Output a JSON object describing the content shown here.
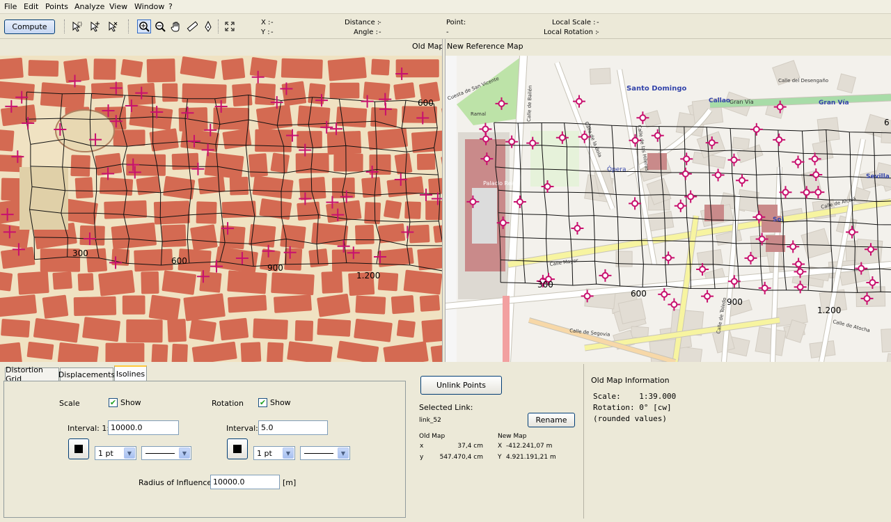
{
  "menu": [
    "File",
    "Edit",
    "Points",
    "Analyze",
    "View",
    "Window",
    "?"
  ],
  "toolbar": {
    "compute_label": "Compute",
    "tools": [
      "select-icon",
      "select-add-icon",
      "select-remove-icon",
      "zoom-in-icon",
      "zoom-out-icon",
      "pan-hand-icon",
      "measure-ruler-icon",
      "pen-icon",
      "fit-extent-icon"
    ],
    "x_label": "X :",
    "x_value": "-",
    "y_label": "Y :",
    "y_value": "-",
    "distance_label": "Distance :",
    "distance_value": "-",
    "angle_label": "Angle :",
    "angle_value": "-",
    "point_label": "Point:",
    "point_value": "-",
    "local_scale_label": "Local Scale :",
    "local_scale_value": "-",
    "local_rotation_label": "Local Rotation :",
    "local_rotation_value": "-"
  },
  "old_map": {
    "title": "Old Map",
    "grid_labels": [
      "300",
      "600",
      "900",
      "1.200",
      "600"
    ]
  },
  "new_map": {
    "title": "New Reference Map",
    "place_labels": [
      "Santo Domingo",
      "Callao",
      "Gran Vía",
      "Gran Vía",
      "Ópera",
      "Sevilla",
      "Sol",
      "Palacio Real"
    ],
    "street_labels": [
      "Calle de Bailén",
      "Calle Mayor",
      "Calle de Segovia",
      "Calle de Toledo",
      "Calle de Alcalá",
      "Calle del Desengaño",
      "Calle de las Hileras",
      "Calle de Atocha",
      "Calle de la Bola",
      "Ramal",
      "Cuesta de San Vicente"
    ],
    "grid_labels": [
      "300",
      "600",
      "900",
      "1.200",
      "6"
    ]
  },
  "tabs": [
    "Distortion Grid",
    "Displacements",
    "Isolines"
  ],
  "active_tab": "Isolines",
  "isolines": {
    "scale_label": "Scale",
    "scale_show_label": "Show",
    "scale_show_checked": true,
    "scale_interval_label": "Interval: 1:",
    "scale_interval_value": "10000.0",
    "scale_width": "1 pt",
    "rotation_label": "Rotation",
    "rotation_show_label": "Show",
    "rotation_show_checked": true,
    "rotation_interval_label": "Interval:",
    "rotation_interval_value": "5.0",
    "rotation_width": "1 pt",
    "radius_label": "Radius of Influence:",
    "radius_value": "10000.0",
    "radius_unit": "[m]"
  },
  "link": {
    "unlink_label": "Unlink Points",
    "selected_link_label": "Selected Link:",
    "selected_link_value": "link_52",
    "rename_label": "Rename",
    "old_map_label": "Old Map",
    "new_map_label": "New Map",
    "old_x_label": "x",
    "old_x_value": "37,4 cm",
    "old_y_label": "y",
    "old_y_value": "547.470,4 cm",
    "new_x_label": "X",
    "new_x_value": "-412.241,07 m",
    "new_y_label": "Y",
    "new_y_value": "4.921.191,21 m"
  },
  "info": {
    "title": "Old Map Information",
    "scale_line": "Scale:    1:39.000",
    "rotation_line": "Rotation: 0° [cw]",
    "note_line": "(rounded values)"
  },
  "colors": {
    "marker": "#c8106e",
    "old_block": "#d46a52",
    "old_street": "#f0e2c2",
    "new_park": "#bde3a8",
    "new_building": "#c98a8a"
  }
}
